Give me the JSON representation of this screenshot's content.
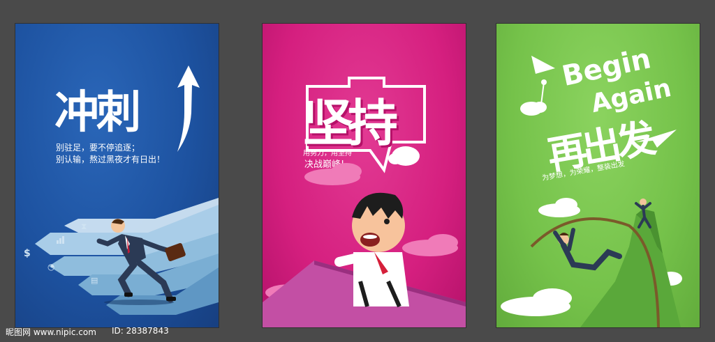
{
  "posters": [
    {
      "title": "冲刺",
      "lines": [
        "别驻足，要不停追逐；",
        "别认输，熬过黑夜才有日出！"
      ],
      "colors": {
        "background": "#1d52a0",
        "arrows": "#a9cde8"
      },
      "icons": [
        "dollar-icon",
        "bar-chart-icon",
        "hourglass-icon",
        "pie-chart-icon",
        "document-icon"
      ]
    },
    {
      "title": "坚持",
      "lines": [
        "用努力，用坚持",
        "决战巅峰!"
      ],
      "colors": {
        "background": "#d51f7f",
        "ramp": "#c34fa4",
        "clouds": "#f07bb8"
      }
    },
    {
      "title_en_1": "Begin",
      "title_en_2": "Again",
      "title": "再出发",
      "line": "为梦想，为荣耀，整装出发",
      "colors": {
        "background": "#75c24a",
        "mountain": "#5aa83a",
        "clouds": "#ffffff"
      }
    }
  ],
  "watermark": {
    "text": "昵图网 www.nipic.com",
    "id_text": "ID: 28387843"
  }
}
